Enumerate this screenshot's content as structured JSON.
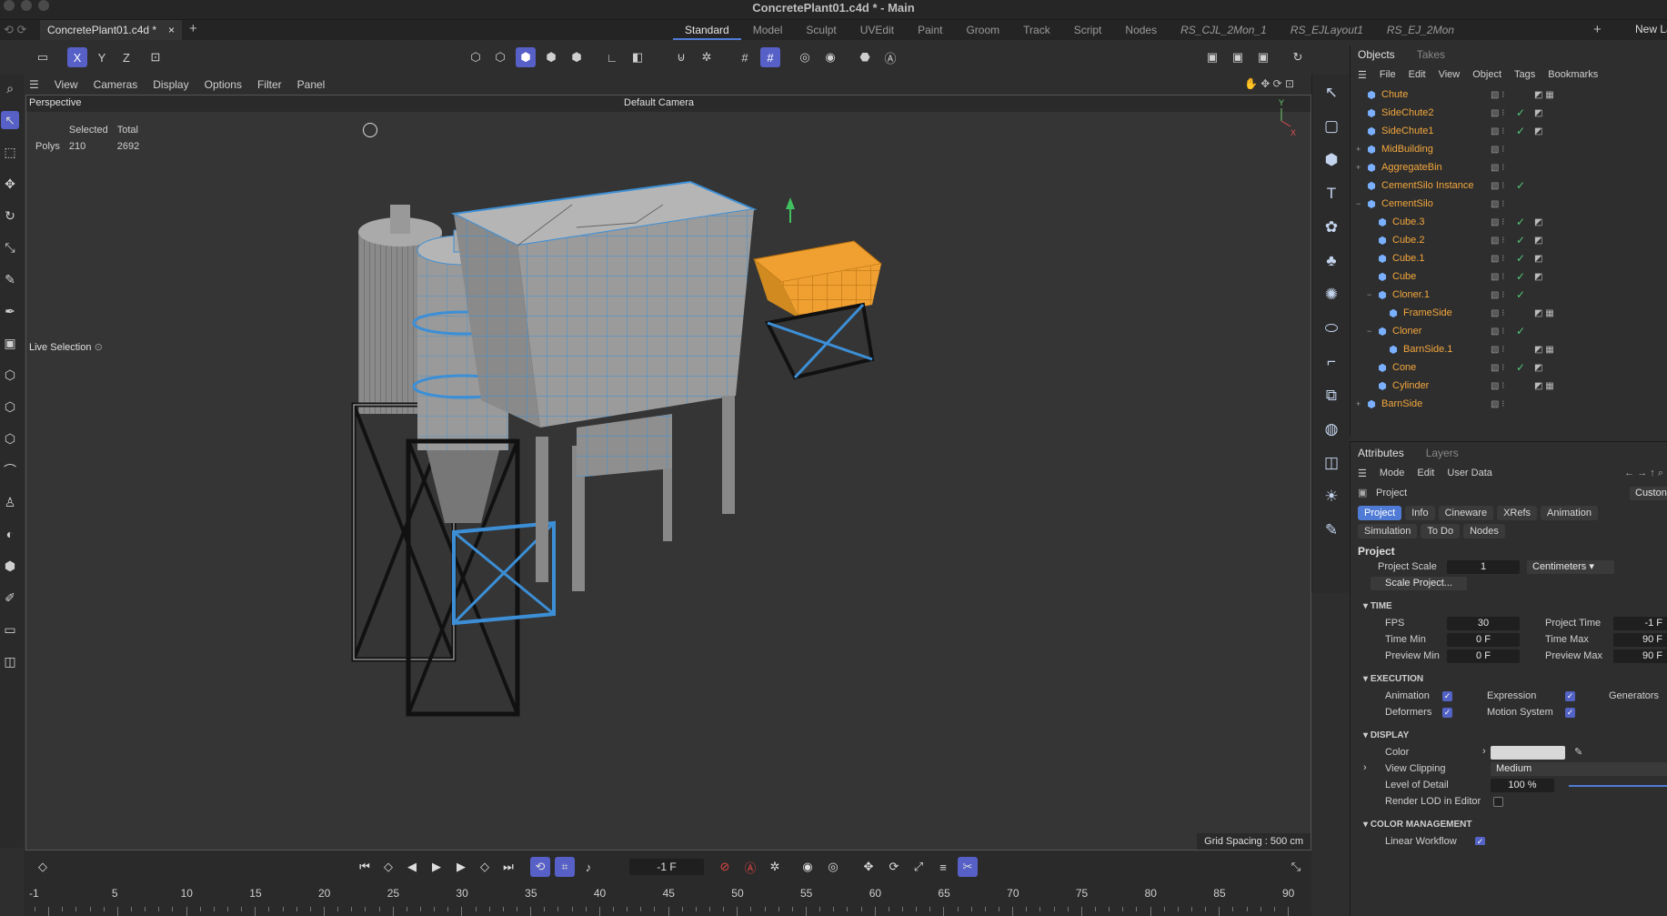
{
  "window": {
    "title": "ConcretePlant01.c4d * - Main"
  },
  "doc_tab": {
    "label": "ConcretePlant01.c4d *",
    "close": "×",
    "add": "+"
  },
  "layouts": [
    {
      "label": "Standard",
      "active": true,
      "italic": false
    },
    {
      "label": "Model",
      "italic": false
    },
    {
      "label": "Sculpt",
      "italic": false
    },
    {
      "label": "UVEdit",
      "italic": false
    },
    {
      "label": "Paint",
      "italic": false
    },
    {
      "label": "Groom",
      "italic": false
    },
    {
      "label": "Track",
      "italic": false
    },
    {
      "label": "Script",
      "italic": false
    },
    {
      "label": "Nodes",
      "italic": false
    },
    {
      "label": "RS_CJL_2Mon_1",
      "italic": true
    },
    {
      "label": "RS_EJLayout1",
      "italic": true
    },
    {
      "label": "RS_EJ_2Mon",
      "italic": true
    }
  ],
  "layout_add": "+",
  "new_layout": "New La",
  "toolbar_axes": [
    "X",
    "Y",
    "Z"
  ],
  "viewport": {
    "menu": [
      "View",
      "Cameras",
      "Display",
      "Options",
      "Filter",
      "Panel"
    ],
    "view_name": "Perspective",
    "camera": "Default Camera",
    "stats": {
      "col_selected": "Selected",
      "col_total": "Total",
      "row_label": "Polys",
      "selected": "210",
      "total": "2692"
    },
    "tool_label": "Live Selection",
    "grid_spacing": "Grid Spacing : 500 cm",
    "axis_labels": {
      "y": "Y",
      "x": "X"
    }
  },
  "objects_panel": {
    "tabs": [
      "Objects",
      "Takes"
    ],
    "menu": [
      "File",
      "Edit",
      "View",
      "Object",
      "Tags",
      "Bookmarks"
    ],
    "items": [
      {
        "name": "Chute",
        "indent": 0,
        "expand": "",
        "check": false,
        "tags": "◩ ▦"
      },
      {
        "name": "SideChute2",
        "indent": 0,
        "expand": "",
        "check": true,
        "tags": "◩"
      },
      {
        "name": "SideChute1",
        "indent": 0,
        "expand": "",
        "check": true,
        "tags": "◩"
      },
      {
        "name": "MidBuilding",
        "indent": 0,
        "expand": "+",
        "check": false,
        "tags": ""
      },
      {
        "name": "AggregateBin",
        "indent": 0,
        "expand": "+",
        "check": false,
        "tags": ""
      },
      {
        "name": "CementSilo Instance",
        "indent": 0,
        "expand": "",
        "check": true,
        "tags": ""
      },
      {
        "name": "CementSilo",
        "indent": 0,
        "expand": "−",
        "check": false,
        "tags": ""
      },
      {
        "name": "Cube.3",
        "indent": 1,
        "expand": "",
        "check": true,
        "tags": "◩"
      },
      {
        "name": "Cube.2",
        "indent": 1,
        "expand": "",
        "check": true,
        "tags": "◩"
      },
      {
        "name": "Cube.1",
        "indent": 1,
        "expand": "",
        "check": true,
        "tags": "◩"
      },
      {
        "name": "Cube",
        "indent": 1,
        "expand": "",
        "check": true,
        "tags": "◩"
      },
      {
        "name": "Cloner.1",
        "indent": 1,
        "expand": "−",
        "check": true,
        "tags": ""
      },
      {
        "name": "FrameSide",
        "indent": 2,
        "expand": "",
        "check": false,
        "tags": "◩ ▦"
      },
      {
        "name": "Cloner",
        "indent": 1,
        "expand": "−",
        "check": true,
        "tags": ""
      },
      {
        "name": "BarnSide.1",
        "indent": 2,
        "expand": "",
        "check": false,
        "tags": "◩ ▦"
      },
      {
        "name": "Cone",
        "indent": 1,
        "expand": "",
        "check": true,
        "tags": "◩"
      },
      {
        "name": "Cylinder",
        "indent": 1,
        "expand": "",
        "check": false,
        "tags": "◩ ▦"
      },
      {
        "name": "BarnSide",
        "indent": 0,
        "expand": "+",
        "check": false,
        "tags": ""
      }
    ]
  },
  "attributes_panel": {
    "tabs": [
      "Attributes",
      "Layers"
    ],
    "menu": [
      "Mode",
      "Edit",
      "User Data"
    ],
    "object_label": "Project",
    "custom_label": "Custon",
    "subtabs_row1": [
      "Project",
      "Info",
      "Cineware",
      "XRefs",
      "Animation"
    ],
    "subtabs_row2": [
      "Simulation",
      "To Do",
      "Nodes"
    ],
    "heading": "Project",
    "project_scale_label": "Project Scale",
    "project_scale_value": "1",
    "project_scale_unit": "Centimeters",
    "scale_button": "Scale Project...",
    "time_section": "TIME",
    "fps_label": "FPS",
    "fps": "30",
    "project_time_label": "Project Time",
    "project_time": "-1 F",
    "time_min_label": "Time Min",
    "time_min": "0 F",
    "time_max_label": "Time Max",
    "time_max": "90 F",
    "preview_min_label": "Preview Min",
    "preview_min": "0 F",
    "preview_max_label": "Preview Max",
    "preview_max": "90 F",
    "execution_section": "EXECUTION",
    "animation_label": "Animation",
    "expression_label": "Expression",
    "generators_label": "Generators",
    "deformers_label": "Deformers",
    "motion_system_label": "Motion System",
    "display_section": "DISPLAY",
    "color_label": "Color",
    "view_clipping_label": "View Clipping",
    "view_clipping_value": "Medium",
    "lod_label": "Level of Detail",
    "lod_value": "100 %",
    "render_lod_label": "Render LOD in Editor",
    "color_management_section": "COLOR MANAGEMENT",
    "linear_workflow_label": "Linear Workflow"
  },
  "timeline": {
    "current_frame": "-1 F",
    "ruler": [
      "-1",
      "5",
      "10",
      "15",
      "20",
      "25",
      "30",
      "35",
      "40",
      "45",
      "50",
      "55",
      "60",
      "65",
      "70",
      "75",
      "80",
      "85",
      "90"
    ]
  },
  "colors": {
    "accent": "#5660c7",
    "object_name": "#f3a73d",
    "check": "#53c978",
    "wire": "#3c8fd6",
    "selected": "#f0a030"
  }
}
